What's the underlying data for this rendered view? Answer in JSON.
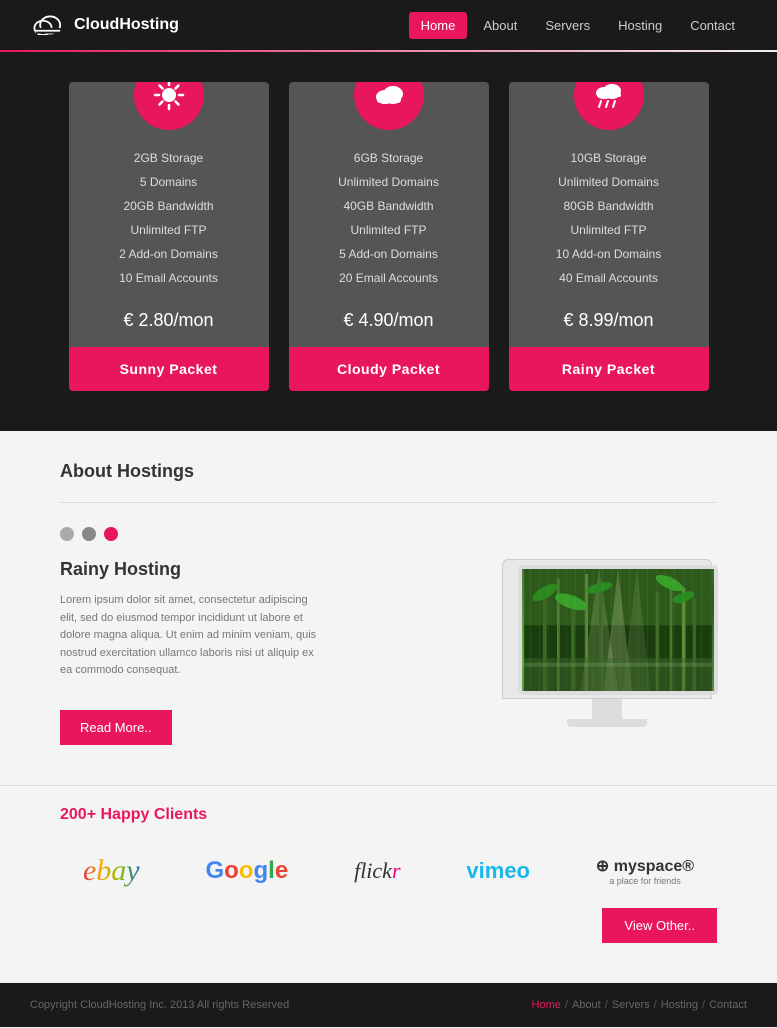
{
  "navbar": {
    "logo_text_light": "Cloud",
    "logo_text_bold": "Hosting",
    "links": [
      {
        "label": "Home",
        "active": true
      },
      {
        "label": "About",
        "active": false
      },
      {
        "label": "Servers",
        "active": false
      },
      {
        "label": "Hosting",
        "active": false
      },
      {
        "label": "Contact",
        "active": false
      }
    ]
  },
  "pricing": {
    "cards": [
      {
        "icon": "☀",
        "features": [
          "2GB Storage",
          "5 Domains",
          "20GB Bandwidth",
          "Unlimited FTP",
          "2 Add-on Domains",
          "10 Email Accounts"
        ],
        "price": "€ 2.80/mon",
        "button": "Sunny Packet"
      },
      {
        "icon": "☁",
        "features": [
          "6GB Storage",
          "Unlimited Domains",
          "40GB Bandwidth",
          "Unlimited FTP",
          "5 Add-on Domains",
          "20 Email Accounts"
        ],
        "price": "€ 4.90/mon",
        "button": "Cloudy Packet"
      },
      {
        "icon": "🌧",
        "features": [
          "10GB Storage",
          "Unlimited Domains",
          "80GB Bandwidth",
          "Unlimited FTP",
          "10 Add-on Domains",
          "40 Email Accounts"
        ],
        "price": "€ 8.99/mon",
        "button": "Rainy Packet"
      }
    ]
  },
  "about": {
    "section_title": "About Hostings",
    "subtitle": "Rainy Hosting",
    "body": "Lorem ipsum dolor sit amet, consectetur adipiscing elit, sed do eiusmod tempor incididunt ut labore et dolore magna aliqua. Ut enim ad minim veniam, quis nostrud exercitation ullamco laboris nisi ut aliquip ex ea commodo consequat.",
    "read_more": "Read More.."
  },
  "clients": {
    "count": "200+",
    "title": "Happy Clients",
    "logos": [
      "ebay",
      "Google",
      "flickr",
      "vimeo",
      "myspace"
    ],
    "view_other": "View Other.."
  },
  "footer": {
    "copy": "Copyright CloudHosting Inc. 2013  All rights Reserved",
    "links": [
      {
        "label": "Home",
        "active": true
      },
      {
        "label": "About",
        "active": false
      },
      {
        "label": "Servers",
        "active": false
      },
      {
        "label": "Hosting",
        "active": false
      },
      {
        "label": "Contact",
        "active": false
      }
    ]
  }
}
